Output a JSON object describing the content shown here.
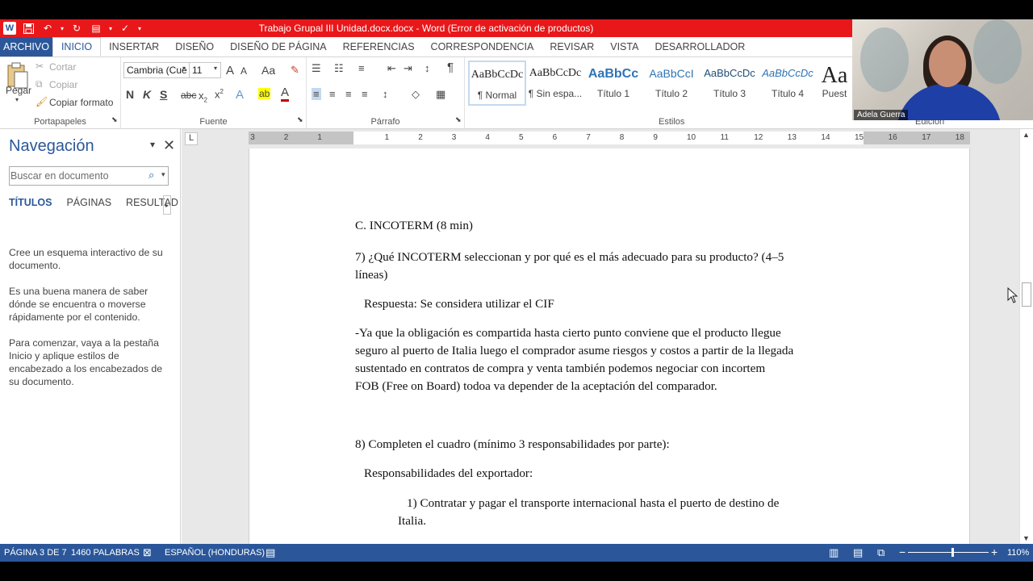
{
  "window": {
    "title": "Trabajo Grupal III Unidad.docx.docx -  Word (Error de activación de productos)"
  },
  "qat": {
    "word_logo": "W",
    "save_icon": "save-icon",
    "undo_icon": "undo-icon",
    "redo_icon": "redo-icon",
    "spell_icon": "spellcheck-icon"
  },
  "tabs": [
    {
      "label": "ARCHIVO"
    },
    {
      "label": "INICIO"
    },
    {
      "label": "INSERTAR"
    },
    {
      "label": "DISEÑO"
    },
    {
      "label": "DISEÑO DE PÁGINA"
    },
    {
      "label": "REFERENCIAS"
    },
    {
      "label": "CORRESPONDENCIA"
    },
    {
      "label": "REVISAR"
    },
    {
      "label": "VISTA"
    },
    {
      "label": "DESARROLLADOR"
    }
  ],
  "clipboard": {
    "paste": "Pegar",
    "cut": "Cortar",
    "copy": "Copiar",
    "format_painter": "Copiar formato",
    "group": "Portapapeles"
  },
  "font": {
    "name": "Cambria (Cue",
    "size": "11",
    "group": "Fuente",
    "grow": "A",
    "shrink": "A",
    "case": "Aa",
    "bold": "N",
    "italic": "K",
    "underline": "S",
    "strike": "abc",
    "subscript": "x",
    "superscript": "x",
    "color_letter": "A"
  },
  "paragraph": {
    "group": "Párrafo",
    "show_marks": "¶"
  },
  "styles": {
    "group": "Estilos",
    "items": [
      {
        "preview": "AaBbCcDc",
        "label": "¶ Normal"
      },
      {
        "preview": "AaBbCcDc",
        "label": "¶ Sin espa..."
      },
      {
        "preview": "AaBbCc",
        "label": "Título 1"
      },
      {
        "preview": "AaBbCcI",
        "label": "Título 2"
      },
      {
        "preview": "AaBbCcDc",
        "label": "Título 3"
      },
      {
        "preview": "AaBbCcDc",
        "label": "Título 4"
      },
      {
        "preview": "Aa",
        "label": "Puest"
      }
    ]
  },
  "editing": {
    "group": "Edición"
  },
  "camera": {
    "name": "Adela Guerra"
  },
  "nav": {
    "title": "Navegación",
    "search_placeholder": "Buscar en documento",
    "tabs": [
      "TÍTULOS",
      "PÁGINAS",
      "RESULTAD"
    ],
    "p1": "Cree un esquema interactivo de su documento.",
    "p2": "Es una buena manera de saber dónde se encuentra o moverse rápidamente por el contenido.",
    "p3": "Para comenzar, vaya a la pestaña Inicio y aplique estilos de encabezado a los encabezados de su documento."
  },
  "ruler": {
    "corner": "L",
    "numbers": [
      "3",
      "2",
      "1",
      "1",
      "2",
      "3",
      "4",
      "5",
      "6",
      "7",
      "8",
      "9",
      "10",
      "11",
      "12",
      "13",
      "14",
      "15",
      "16",
      "17",
      "18"
    ]
  },
  "document": {
    "lines": [
      "C. INCOTERM (8 min)",
      "7) ¿Qué INCOTERM seleccionan y por qué es el más adecuado para su producto? (4–5",
      "líneas)",
      "Respuesta: Se considera utilizar el CIF",
      "-Ya que la obligación es compartida hasta cierto punto  conviene que el producto llegue",
      "seguro   al puerto de Italia luego  el comprador asume riesgos y costos a partir de la llegada",
      "sustentado en contratos de compra y venta  también podemos negociar con incortem",
      "FOB (Free on Board) todoa va depender de la aceptación del comparador.",
      "8) Completen el cuadro (mínimo 3 responsabilidades por parte):",
      "Responsabilidades del exportador:",
      "1) Contratar y pagar el transporte internacional hasta el puerto de destino de",
      "Italia."
    ]
  },
  "status": {
    "page": "PÁGINA 3 DE 7",
    "words": "1460 PALABRAS",
    "language": "ESPAÑOL (HONDURAS)",
    "zoom": "110%",
    "zoom_fraction": 0.55
  }
}
